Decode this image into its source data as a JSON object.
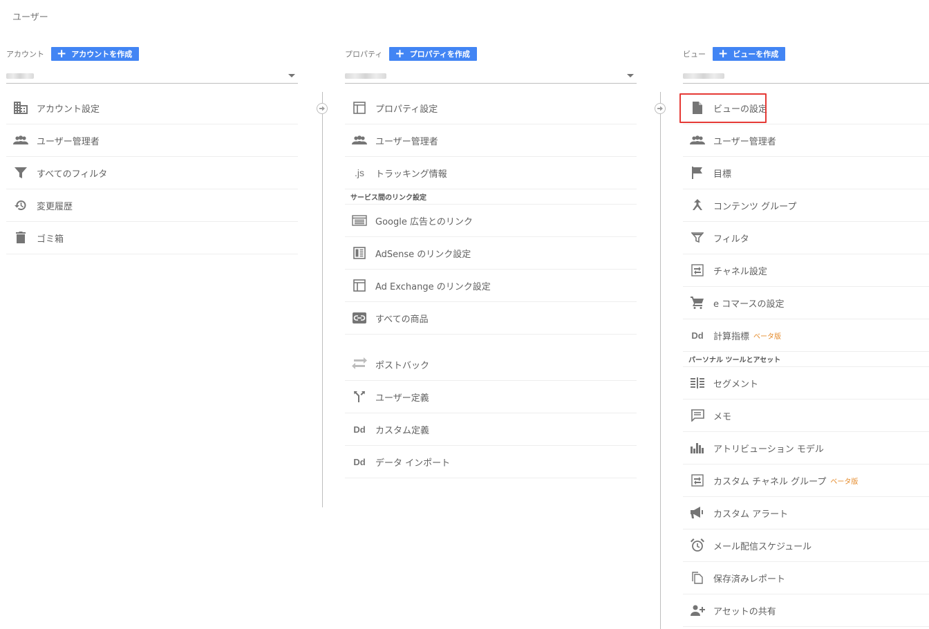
{
  "page": {
    "title": "ユーザー"
  },
  "account": {
    "label": "アカウント",
    "create_label": "アカウントを作成",
    "items": [
      {
        "label": "アカウント設定",
        "icon": "building-icon"
      },
      {
        "label": "ユーザー管理者",
        "icon": "people-icon"
      },
      {
        "label": "すべてのフィルタ",
        "icon": "filter-icon"
      },
      {
        "label": "変更履歴",
        "icon": "history-icon"
      },
      {
        "label": "ゴミ箱",
        "icon": "trash-icon"
      }
    ]
  },
  "property": {
    "label": "プロパティ",
    "create_label": "プロパティを作成",
    "items": [
      {
        "label": "プロパティ設定",
        "icon": "layout-icon"
      },
      {
        "label": "ユーザー管理者",
        "icon": "people-icon"
      },
      {
        "label": "トラッキング情報",
        "icon": "js-icon"
      }
    ],
    "section_label": "サービス間のリンク設定",
    "link_items": [
      {
        "label": "Google 広告とのリンク",
        "icon": "ads-icon"
      },
      {
        "label": "AdSense のリンク設定",
        "icon": "adsense-icon"
      },
      {
        "label": "Ad Exchange のリンク設定",
        "icon": "layout-icon"
      },
      {
        "label": "すべての商品",
        "icon": "link-icon"
      }
    ],
    "extra_items": [
      {
        "label": "ポストバック",
        "icon": "swap-icon"
      },
      {
        "label": "ユーザー定義",
        "icon": "fork-icon"
      },
      {
        "label": "カスタム定義",
        "icon": "dd-icon"
      },
      {
        "label": "データ インポート",
        "icon": "dd-icon"
      }
    ]
  },
  "view": {
    "label": "ビュー",
    "create_label": "ビューを作成",
    "items": [
      {
        "label": "ビューの設定",
        "icon": "document-icon"
      },
      {
        "label": "ユーザー管理者",
        "icon": "people-icon"
      },
      {
        "label": "目標",
        "icon": "flag-icon"
      },
      {
        "label": "コンテンツ グループ",
        "icon": "content-group-icon"
      },
      {
        "label": "フィルタ",
        "icon": "filter-icon"
      },
      {
        "label": "チャネル設定",
        "icon": "channel-icon"
      },
      {
        "label": "e コマースの設定",
        "icon": "cart-icon"
      },
      {
        "label": "計算指標",
        "icon": "dd-icon",
        "badge": "ベータ版"
      }
    ],
    "section_label": "パーソナル ツールとアセット",
    "personal_items": [
      {
        "label": "セグメント",
        "icon": "segment-icon"
      },
      {
        "label": "メモ",
        "icon": "memo-icon"
      },
      {
        "label": "アトリビューション モデル",
        "icon": "attribution-icon"
      },
      {
        "label": "カスタム チャネル グループ",
        "icon": "channel-icon",
        "badge": "ベータ版"
      },
      {
        "label": "カスタム アラート",
        "icon": "megaphone-icon"
      },
      {
        "label": "メール配信スケジュール",
        "icon": "alarm-icon"
      },
      {
        "label": "保存済みレポート",
        "icon": "copy-icon"
      },
      {
        "label": "アセットの共有",
        "icon": "person-add-icon"
      }
    ]
  },
  "colors": {
    "accent": "#4285f4",
    "highlight": "#e53935",
    "beta": "#e58b2b"
  }
}
